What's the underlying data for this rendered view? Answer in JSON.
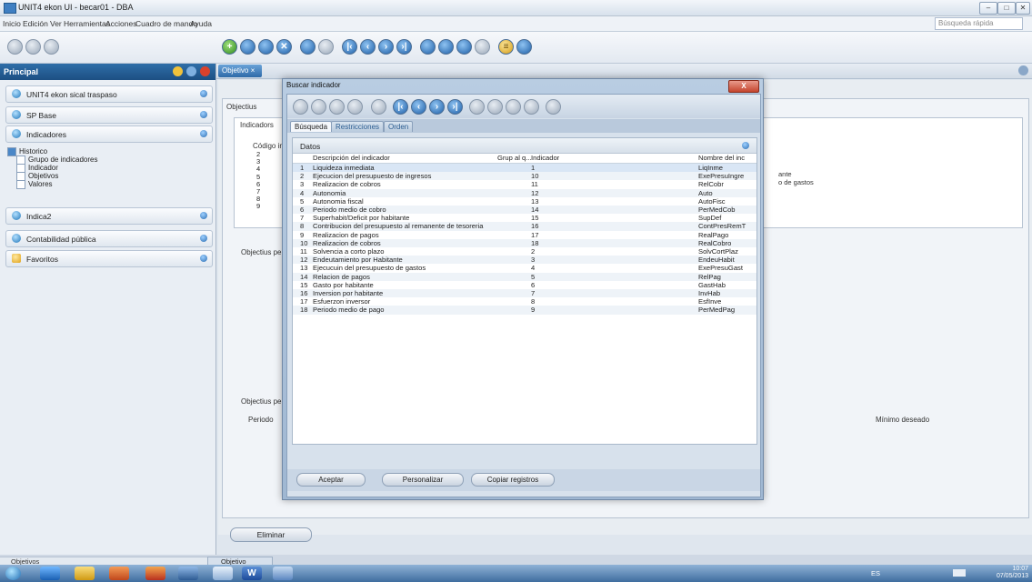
{
  "window": {
    "title": "UNIT4 ekon UI - becar01 - DBA"
  },
  "menubar": {
    "items": [
      "Inicio",
      "Edición",
      "Ver",
      "Herramientas",
      "Acciones",
      "Cuadro de mando",
      "Ayuda"
    ],
    "search_placeholder": "Búsqueda rápida"
  },
  "leftpanel": {
    "header": "Principal",
    "sections": [
      {
        "label": "UNIT4 ekon sical traspaso"
      },
      {
        "label": "SP Base"
      },
      {
        "label": "Indicadores"
      },
      {
        "label": "Indica2"
      },
      {
        "label": "Contabilidad pública"
      },
      {
        "label": "Favoritos"
      }
    ],
    "tree": [
      "Historico",
      "Grupo de indicadores",
      "Indicador",
      "Objetivos",
      "Valores"
    ],
    "bottom_label": "Objetivos"
  },
  "main": {
    "tab_label": "Objetivo",
    "panel_label": "Objectius",
    "sub_label": "Indicadors",
    "codigo_header": "Código in",
    "codigos": [
      "2",
      "3",
      "4",
      "5",
      "6",
      "7",
      "8",
      "9"
    ],
    "right_texts": [
      "ante",
      "o de gastos"
    ],
    "objectius_per_1": "Objectius per",
    "objectius_per_2": "Objectius per",
    "periodo_header": "Periodo",
    "minimo_header": "Mínimo deseado",
    "eliminar_label": "Eliminar"
  },
  "dialog": {
    "title": "Buscar indicador",
    "close_label": "X",
    "tabs": [
      "Búsqueda",
      "Restricciones",
      "Orden"
    ],
    "panel_title": "Datos",
    "columns": [
      "Descripción del indicador",
      "Grup al q...",
      "Indicador",
      "Nombre del inc"
    ],
    "rows": [
      {
        "n": "1",
        "desc": "Liquideza inmediata",
        "ind": "1",
        "nombre": "LiqInme"
      },
      {
        "n": "2",
        "desc": "Ejecucion del presupuesto de ingresos",
        "ind": "10",
        "nombre": "ExePresuIngre"
      },
      {
        "n": "3",
        "desc": "Realizacion de cobros",
        "ind": "11",
        "nombre": "RelCobr"
      },
      {
        "n": "4",
        "desc": "Autonomia",
        "ind": "12",
        "nombre": "Auto"
      },
      {
        "n": "5",
        "desc": "Autonomia fiscal",
        "ind": "13",
        "nombre": "AutoFisc"
      },
      {
        "n": "6",
        "desc": "Periodo medio de cobro",
        "ind": "14",
        "nombre": "PerMedCob"
      },
      {
        "n": "7",
        "desc": "Superhabit/Deficit por habitante",
        "ind": "15",
        "nombre": "SupDef"
      },
      {
        "n": "8",
        "desc": "Contribucion del presupuesto al remanente de tesoreria",
        "ind": "16",
        "nombre": "ContPresRemT"
      },
      {
        "n": "9",
        "desc": "Realizacion de pagos",
        "ind": "17",
        "nombre": "RealPago"
      },
      {
        "n": "10",
        "desc": "Realizacion de cobros",
        "ind": "18",
        "nombre": "RealCobro"
      },
      {
        "n": "11",
        "desc": "Solvencia a corto plazo",
        "ind": "2",
        "nombre": "SolvCortPlaz"
      },
      {
        "n": "12",
        "desc": "Endeutamiento por Habitante",
        "ind": "3",
        "nombre": "EndeuHabit"
      },
      {
        "n": "13",
        "desc": "Ejecucuin del presupuesto de gastos",
        "ind": "4",
        "nombre": "ExePresuGast"
      },
      {
        "n": "14",
        "desc": "Relacion de pagos",
        "ind": "5",
        "nombre": "RelPag"
      },
      {
        "n": "15",
        "desc": "Gasto por habitante",
        "ind": "6",
        "nombre": "GastHab"
      },
      {
        "n": "16",
        "desc": "Inversion por habitante",
        "ind": "7",
        "nombre": "InvHab"
      },
      {
        "n": "17",
        "desc": "Esfuerzon inversor",
        "ind": "8",
        "nombre": "EsfInve"
      },
      {
        "n": "18",
        "desc": "Periodo medio de pago",
        "ind": "9",
        "nombre": "PerMedPag"
      }
    ],
    "buttons": [
      "Aceptar",
      "Personalizar",
      "Copiar registros"
    ]
  },
  "taskbar": {
    "task_label": "Objetivo",
    "lang": "ES",
    "time": "10:07",
    "date": "07/05/2013"
  },
  "colors": {
    "accent": "#1d4f83",
    "selection": "#d9e6f5"
  }
}
